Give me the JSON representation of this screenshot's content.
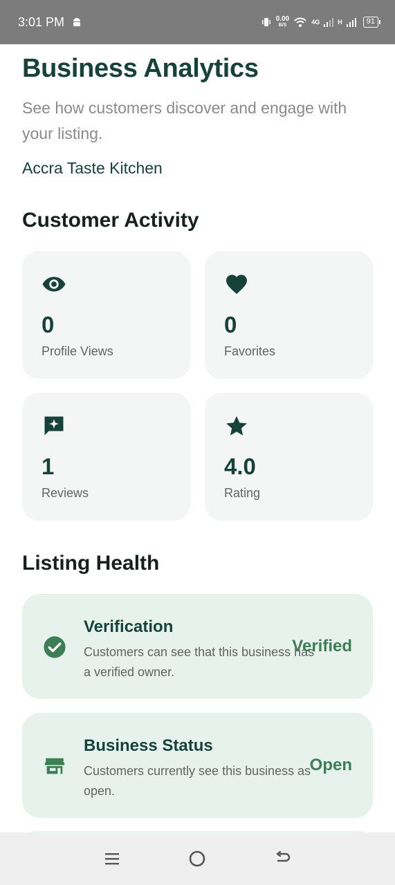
{
  "status_bar": {
    "time": "3:01 PM",
    "net_speed_value": "0.00",
    "net_speed_unit": "B/S",
    "network_4g": "4G",
    "network_h": "H",
    "battery": "91"
  },
  "header": {
    "title": "Business Analytics",
    "subtitle": "See how customers discover and engage with your listing.",
    "business_name": "Accra Taste Kitchen"
  },
  "customer_activity": {
    "title": "Customer Activity",
    "cards": [
      {
        "icon": "eye-icon",
        "value": "0",
        "label": "Profile Views"
      },
      {
        "icon": "heart-icon",
        "value": "0",
        "label": "Favorites"
      },
      {
        "icon": "review-icon",
        "value": "1",
        "label": "Reviews"
      },
      {
        "icon": "star-icon",
        "value": "4.0",
        "label": "Rating"
      }
    ]
  },
  "listing_health": {
    "title": "Listing Health",
    "items": [
      {
        "icon": "check-circle-icon",
        "title": "Verification",
        "description": "Customers can see that this business has a verified owner.",
        "value": "Verified"
      },
      {
        "icon": "store-icon",
        "title": "Business Status",
        "description": "Customers currently see this business as open.",
        "value": "Open"
      }
    ]
  },
  "colors": {
    "primary_dark": "#17423a",
    "accent_green": "#3d7e55",
    "card_bg": "#f3f6f5",
    "health_card_bg": "#e8f2ec"
  }
}
